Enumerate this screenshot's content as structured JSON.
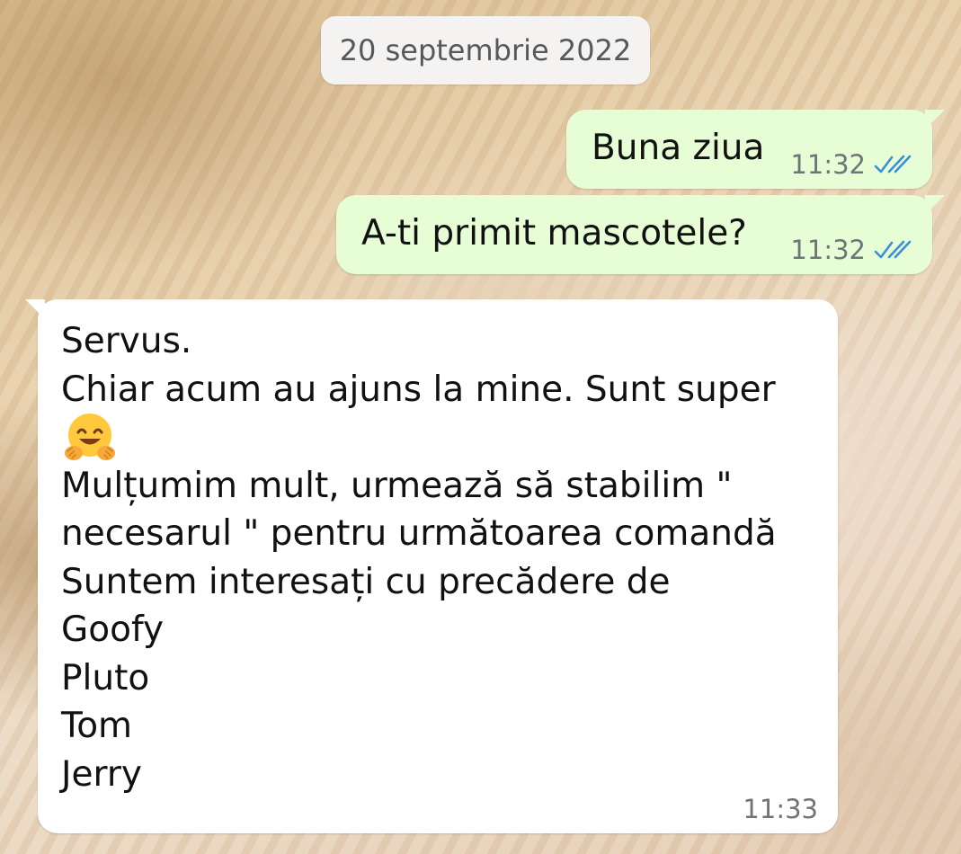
{
  "chat": {
    "date_chip": "20 septembrie 2022",
    "messages": [
      {
        "direction": "outgoing",
        "text": "Buna ziua",
        "time": "11:32",
        "status": "read-double-check"
      },
      {
        "direction": "outgoing",
        "text": "A-ti primit mascotele?",
        "time": "11:32",
        "status": "read-double-check"
      },
      {
        "direction": "incoming",
        "lines": [
          "Servus.",
          "Chiar acum au ajuns la mine. Sunt super",
          "Mulțumim mult, urmează să stabilim \"",
          "necesarul \" pentru următoarea comandă",
          "Suntem interesați cu precădere de",
          "Goofy",
          "Pluto",
          "Tom",
          "Jerry"
        ],
        "emoji": "hugging-face-icon",
        "time": "11:33"
      }
    ]
  },
  "colors": {
    "outgoing_bubble": "#e7fdd6",
    "incoming_bubble": "#ffffff",
    "read_ticks": "#3a8fd6",
    "meta_text": "#6f7478"
  }
}
